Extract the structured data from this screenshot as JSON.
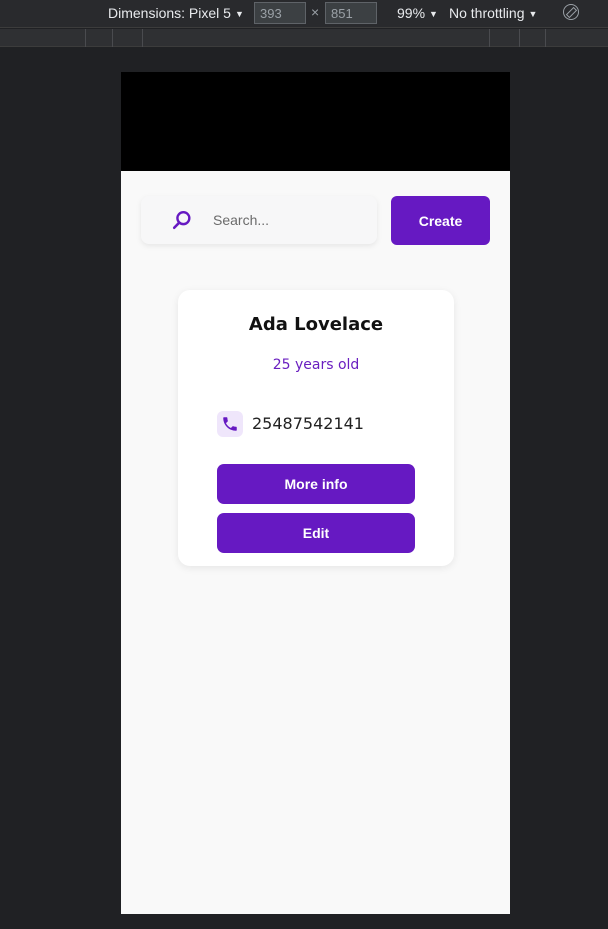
{
  "devtools": {
    "dimensions_label": "Dimensions: Pixel 5",
    "width_value": "393",
    "times_symbol": "×",
    "height_value": "851",
    "zoom_label": "99%",
    "throttling_label": "No throttling",
    "caret": "▼"
  },
  "search": {
    "placeholder": "Search...",
    "value": ""
  },
  "create_button_label": "Create",
  "card": {
    "name": "Ada Lovelace",
    "age": "25 years old",
    "phone": "25487542141",
    "more_info_label": "More info",
    "edit_label": "Edit"
  },
  "colors": {
    "accent": "#6619c2",
    "age_text": "#6a1fc0",
    "phone_icon_bg": "#efe6fb",
    "page_bg": "#f9f9f9",
    "devtools_bg": "#202124"
  },
  "icons": {
    "search": "search-icon",
    "phone": "phone-icon",
    "rotate": "rotate-icon"
  }
}
